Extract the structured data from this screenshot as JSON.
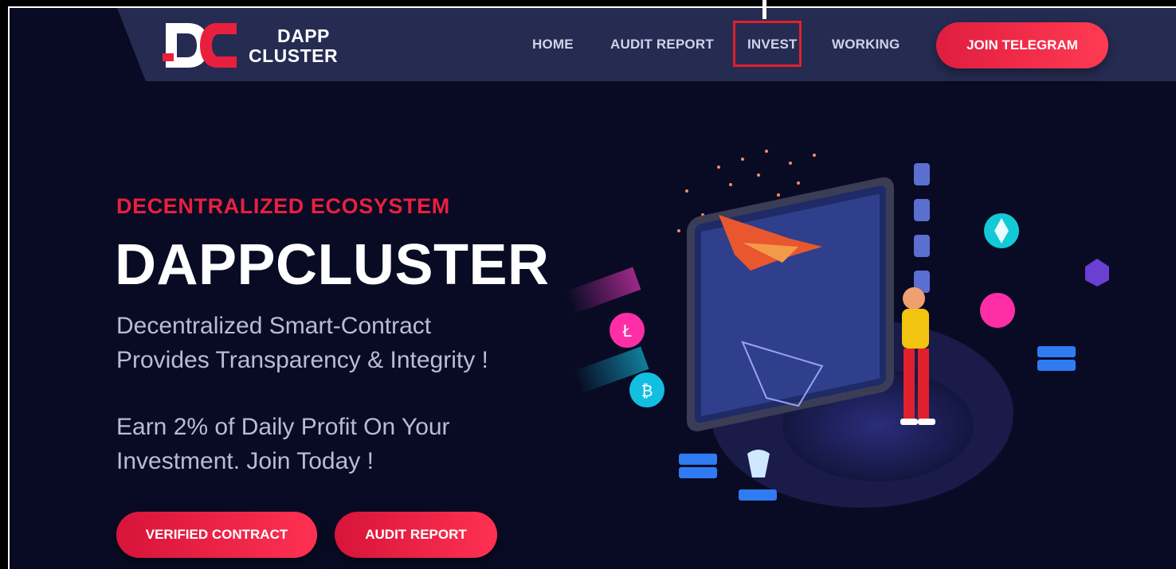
{
  "brand": {
    "line1": "DAPP",
    "line2": "CLUSTER",
    "logo_icon": "dc-logo-icon"
  },
  "nav": {
    "items": [
      {
        "label": "HOME"
      },
      {
        "label": "AUDIT REPORT"
      },
      {
        "label": "INVEST",
        "highlighted": true
      },
      {
        "label": "WORKING"
      }
    ],
    "cta": "JOIN TELEGRAM"
  },
  "hero": {
    "eyebrow": "DECENTRALIZED ECOSYSTEM",
    "title": "DAPPCLUSTER",
    "description_line1": "Decentralized Smart-Contract",
    "description_line2": "Provides Transparency & Integrity !",
    "earn_line1": "Earn 2% of Daily Profit On Your",
    "earn_line2": "Investment. Join Today !",
    "buttons": {
      "verified": "VERIFIED CONTRACT",
      "audit": "AUDIT REPORT"
    }
  },
  "illustration": {
    "subject": "vr-gamer-phone-crypto-icon",
    "icons": [
      "litecoin-icon",
      "bitcoin-icon",
      "ethereum-icon",
      "ripple-icon",
      "token-shield-icon"
    ]
  },
  "colors": {
    "background": "#090b24",
    "navbar": "#262b52",
    "accent": "#e8203e",
    "highlight": "#e0202c"
  }
}
